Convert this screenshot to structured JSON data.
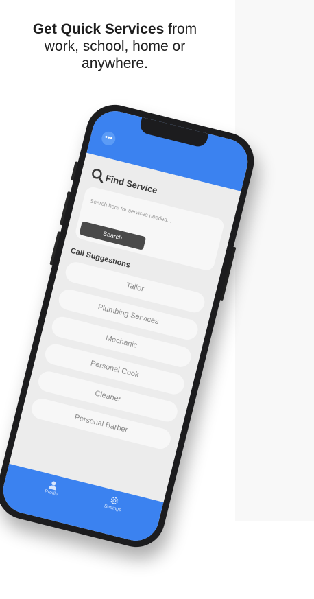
{
  "headline": {
    "bold": "Get Quick Services",
    "rest": " from work, school, home or anywhere."
  },
  "app": {
    "menu_icon": "ellipsis-icon",
    "find_service": {
      "icon": "search-icon",
      "title": "Find Service"
    },
    "search": {
      "placeholder": "Search here for services needed...",
      "value": "",
      "button_label": "Search"
    },
    "suggestions": {
      "title": "Call Suggestions",
      "items": [
        {
          "label": "Tailor"
        },
        {
          "label": "Plumbing Services"
        },
        {
          "label": "Mechanic"
        },
        {
          "label": "Personal Cook"
        },
        {
          "label": "Cleaner"
        },
        {
          "label": "Personal Barber"
        }
      ]
    },
    "tabs": [
      {
        "label": "Profile",
        "icon": "person-icon"
      },
      {
        "label": "Settings",
        "icon": "gear-icon"
      }
    ]
  },
  "colors": {
    "accent": "#3b82f0",
    "button_dark": "#4a4a4a",
    "phone_frame": "#1c1c1e",
    "screen_bg": "#ececec"
  }
}
